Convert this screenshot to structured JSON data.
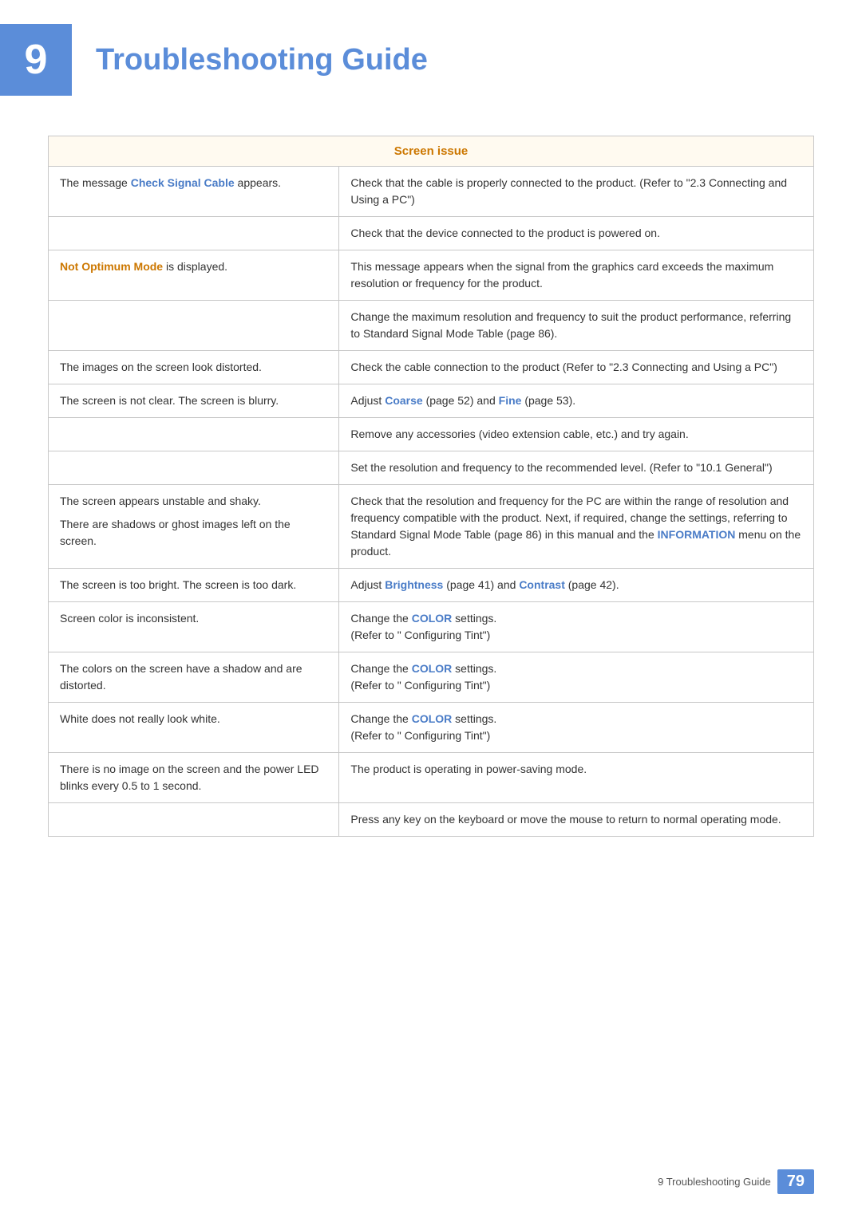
{
  "header": {
    "chapter_number": "9",
    "title": "Troubleshooting Guide"
  },
  "table": {
    "section_header": "Screen issue",
    "rows": [
      {
        "problem": "The message __Check Signal Cable__ appears.",
        "problem_parts": [
          {
            "text": "The message ",
            "bold": false,
            "color": null
          },
          {
            "text": "Check Signal Cable",
            "bold": true,
            "color": "blue"
          },
          {
            "text": " appears.",
            "bold": false,
            "color": null
          }
        ],
        "solutions": [
          "Check that the cable is properly connected to the product. (Refer to \"2.3 Connecting and Using a PC\")",
          "Check that the device connected to the product is powered on."
        ]
      },
      {
        "problem": "__Not Optimum Mode__ is displayed.",
        "problem_parts": [
          {
            "text": "Not Optimum Mode",
            "bold": true,
            "color": "orange"
          },
          {
            "text": " is displayed.",
            "bold": false,
            "color": null
          }
        ],
        "solutions": [
          "This message appears when the signal from the graphics card exceeds the maximum resolution or frequency for the product.",
          "Change the maximum resolution and frequency to suit the product performance, referring to Standard Signal Mode Table (page 86)."
        ]
      },
      {
        "problem": "The images on the screen look distorted.",
        "problem_parts": [
          {
            "text": "The images on the screen look distorted.",
            "bold": false,
            "color": null
          }
        ],
        "solutions": [
          "Check the cable connection to the product (Refer to \"2.3 Connecting and Using a PC\")"
        ]
      },
      {
        "problem": "The screen is not clear. The screen is blurry.",
        "problem_parts": [
          {
            "text": "The screen is not clear. The screen is blurry.",
            "bold": false,
            "color": null
          }
        ],
        "solutions": [
          "__Coarse_blue__ (page 52) and __Fine_blue__ (page 53).",
          "Remove any accessories (video extension cable, etc.) and try again.",
          "Set the resolution and frequency to the recommended level. (Refer to \"10.1 General\")"
        ],
        "solution_parts": [
          [
            {
              "text": "Adjust ",
              "bold": false
            },
            {
              "text": "Coarse",
              "bold": true,
              "color": "blue"
            },
            {
              "text": " (page 52) and ",
              "bold": false
            },
            {
              "text": "Fine",
              "bold": true,
              "color": "blue"
            },
            {
              "text": " (page 53).",
              "bold": false
            }
          ],
          [
            {
              "text": "Remove any accessories (video extension cable, etc.) and try again.",
              "bold": false
            }
          ],
          [
            {
              "text": "Set the resolution and frequency to the recommended level. (Refer to \"10.1 General\")",
              "bold": false
            }
          ]
        ]
      },
      {
        "problem_merged": true,
        "problems": [
          "The screen appears unstable and shaky.",
          "There are shadows or ghost images left on the screen."
        ],
        "solution_parts": [
          [
            {
              "text": "Check that the resolution and frequency for the PC are within the range of resolution and frequency compatible with the product. Next, if required, change the settings, referring to Standard Signal Mode Table (page 86) in this manual and the ",
              "bold": false
            },
            {
              "text": "INFORMATION",
              "bold": true,
              "color": "blue"
            },
            {
              "text": " menu on the product.",
              "bold": false
            }
          ]
        ]
      },
      {
        "problem_parts": [
          {
            "text": "The screen is too bright. The screen is too dark.",
            "bold": false,
            "color": null
          }
        ],
        "solution_parts": [
          [
            {
              "text": "Adjust ",
              "bold": false
            },
            {
              "text": "Brightness",
              "bold": true,
              "color": "blue"
            },
            {
              "text": " (page 41) and ",
              "bold": false
            },
            {
              "text": "Contrast",
              "bold": true,
              "color": "blue"
            },
            {
              "text": " (page 42).",
              "bold": false
            }
          ]
        ]
      },
      {
        "problem_parts": [
          {
            "text": "Screen color is inconsistent.",
            "bold": false
          }
        ],
        "solution_parts": [
          [
            {
              "text": "Change the ",
              "bold": false
            },
            {
              "text": "COLOR",
              "bold": true,
              "color": "blue"
            },
            {
              "text": " settings.",
              "bold": false
            }
          ],
          [
            {
              "text": "(Refer to \" Configuring Tint\")",
              "bold": false
            }
          ]
        ]
      },
      {
        "problem_merged": true,
        "problems": [
          "The colors on the screen have a shadow and are distorted."
        ],
        "solution_parts": [
          [
            {
              "text": "Change the ",
              "bold": false
            },
            {
              "text": "COLOR",
              "bold": true,
              "color": "blue"
            },
            {
              "text": " settings.",
              "bold": false
            }
          ],
          [
            {
              "text": "(Refer to \" Configuring Tint\")",
              "bold": false
            }
          ]
        ]
      },
      {
        "problem_parts": [
          {
            "text": "White does not really look white.",
            "bold": false
          }
        ],
        "solution_parts": [
          [
            {
              "text": "Change the ",
              "bold": false
            },
            {
              "text": "COLOR",
              "bold": true,
              "color": "blue"
            },
            {
              "text": " settings.",
              "bold": false
            }
          ],
          [
            {
              "text": "(Refer to \" Configuring Tint\")",
              "bold": false
            }
          ]
        ]
      },
      {
        "problem_merged": true,
        "problems": [
          "There is no image on the screen and the power LED blinks every 0.5 to 1 second."
        ],
        "solution_parts": [
          [
            {
              "text": "The product is operating in power-saving mode.",
              "bold": false
            }
          ],
          [
            {
              "text": "Press any key on the keyboard or move the mouse to return to normal operating mode.",
              "bold": false
            }
          ]
        ]
      }
    ]
  },
  "footer": {
    "text": "9 Troubleshooting Guide",
    "page_number": "79"
  }
}
